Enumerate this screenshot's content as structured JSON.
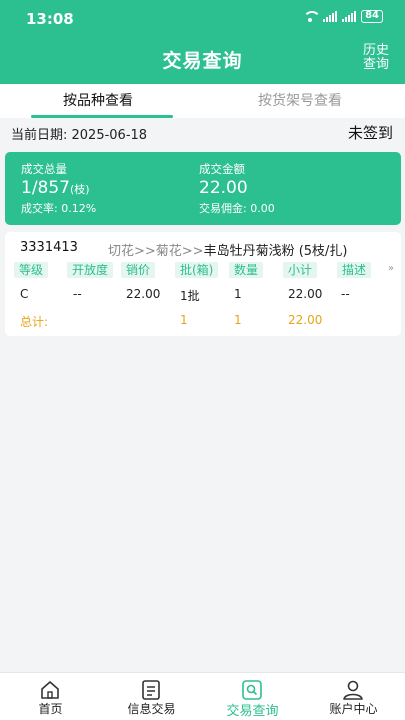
{
  "status": {
    "time": "13:08",
    "battery": "84"
  },
  "header": {
    "title": "交易查询",
    "history_label": "历史查询"
  },
  "tabs": [
    {
      "label": "按品种查看"
    },
    {
      "label": "按货架号查看"
    }
  ],
  "date": {
    "label": "当前日期:  2025-06-18",
    "signin_status": "未签到"
  },
  "summary": {
    "total_volume_label": "成交总量",
    "total_volume_value": "1/857",
    "total_volume_unit": "(枝)",
    "rate_label": "成交率:  0.12%",
    "amount_label": "成交金额",
    "amount_value": "22.00",
    "commission_label": "交易佣金:  0.00"
  },
  "record": {
    "code": "3331413",
    "category_prefix": "切花>>菊花>>",
    "category_name": "丰岛牡丹菊浅粉 (5枝/扎)",
    "columns": [
      "等级",
      "开放度",
      "销价",
      "批(箱)",
      "数量",
      "小计",
      "描述"
    ],
    "more_icon": "chevron-double-right-icon",
    "row": [
      "C",
      "--",
      "22.00",
      "1批",
      "1",
      "22.00",
      "--"
    ],
    "total_label": "总计:",
    "total_row": [
      "1",
      "1",
      "22.00"
    ]
  },
  "bottom_nav": [
    {
      "label": "首页",
      "icon": "home-icon"
    },
    {
      "label": "信息交易",
      "icon": "document-icon"
    },
    {
      "label": "交易查询",
      "icon": "search-icon",
      "active": true
    },
    {
      "label": "账户中心",
      "icon": "user-icon"
    }
  ],
  "colors": {
    "primary": "#2cbf8f",
    "accent": "#e8a317"
  }
}
